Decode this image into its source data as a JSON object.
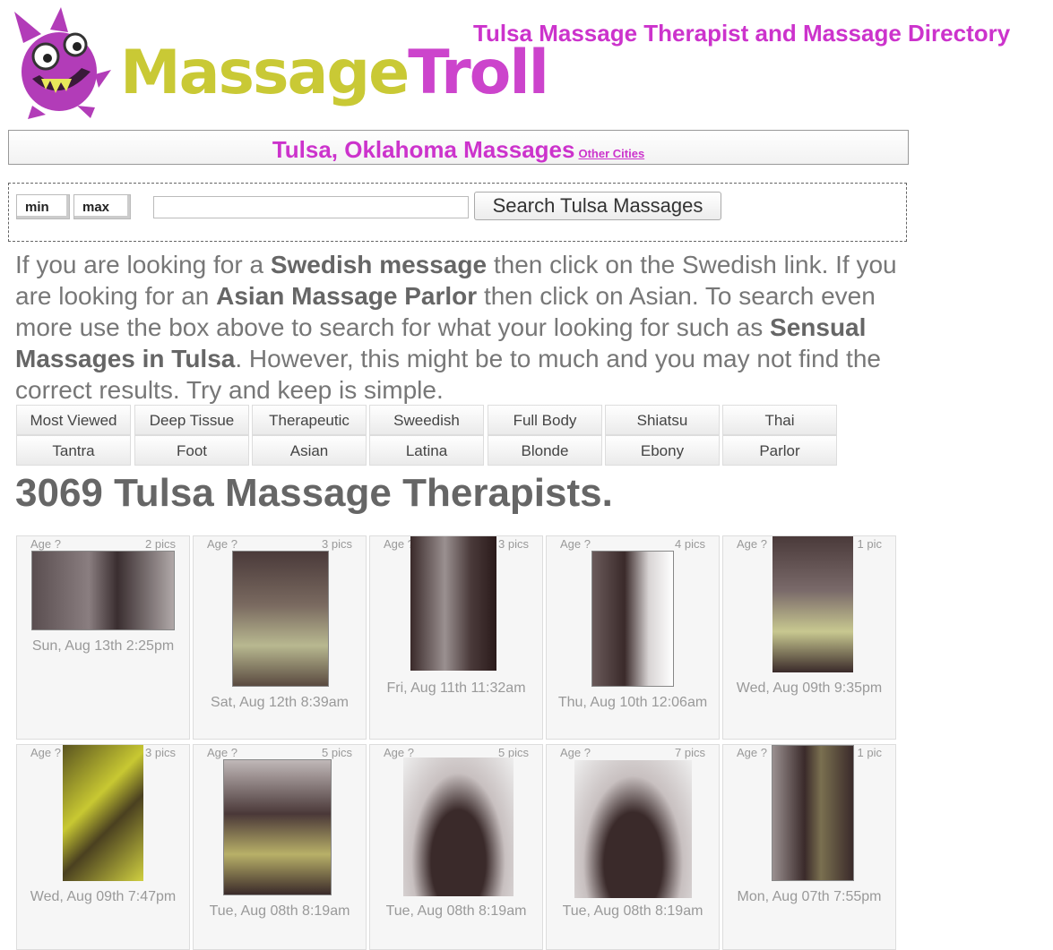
{
  "brand": {
    "logo_part1": "Massage",
    "logo_part2": "Troll",
    "colors": {
      "purple": "#cc44cc",
      "yellow": "#c9c935"
    }
  },
  "header": {
    "title": "Tulsa Massage Therapist and Massage Directory"
  },
  "city_bar": {
    "city": "Tulsa, Oklahoma Massages",
    "other_link": "Other Cities"
  },
  "search": {
    "min_label": "min",
    "max_label": "max",
    "query_value": "",
    "button_label": "Search Tulsa Massages"
  },
  "intro": {
    "p1": "If you are looking for a ",
    "b1": "Swedish message",
    "p2": " then click on the Swedish link. If you are looking for an ",
    "b2": "Asian Massage Parlor",
    "p3": " then click on Asian. To search even more use the box above to search for what your looking for such as ",
    "b3": "Sensual Massages in Tulsa",
    "p4": ". However, this might be to much and you may not find the correct results. Try and keep is simple."
  },
  "categories": [
    "Most Viewed",
    "Deep Tissue",
    "Therapeutic",
    "Sweedish",
    "Full Body",
    "Shiatsu",
    "Thai",
    "Tantra",
    "Foot",
    "Asian",
    "Latina",
    "Blonde",
    "Ebony",
    "Parlor"
  ],
  "total_heading": "3069 Tulsa Massage Therapists.",
  "listings": [
    {
      "age": "Age ?",
      "pics": "2 pics",
      "date": "Sun, Aug 13th 2:25pm"
    },
    {
      "age": "Age ?",
      "pics": "3 pics",
      "date": "Sat, Aug 12th 8:39am"
    },
    {
      "age": "Age ?",
      "pics": "3 pics",
      "date": "Fri, Aug 11th 11:32am"
    },
    {
      "age": "Age ?",
      "pics": "4 pics",
      "date": "Thu, Aug 10th 12:06am"
    },
    {
      "age": "Age ?",
      "pics": "1 pic",
      "date": "Wed, Aug 09th 9:35pm"
    },
    {
      "age": "Age ?",
      "pics": "3 pics",
      "date": "Wed, Aug 09th 7:47pm"
    },
    {
      "age": "Age ?",
      "pics": "5 pics",
      "date": "Tue, Aug 08th 8:19am"
    },
    {
      "age": "Age ?",
      "pics": "5 pics",
      "date": "Tue, Aug 08th 8:19am"
    },
    {
      "age": "Age ?",
      "pics": "7 pics",
      "date": "Tue, Aug 08th 8:19am"
    },
    {
      "age": "Age ?",
      "pics": "1 pic",
      "date": "Mon, Aug 07th 7:55pm"
    }
  ]
}
